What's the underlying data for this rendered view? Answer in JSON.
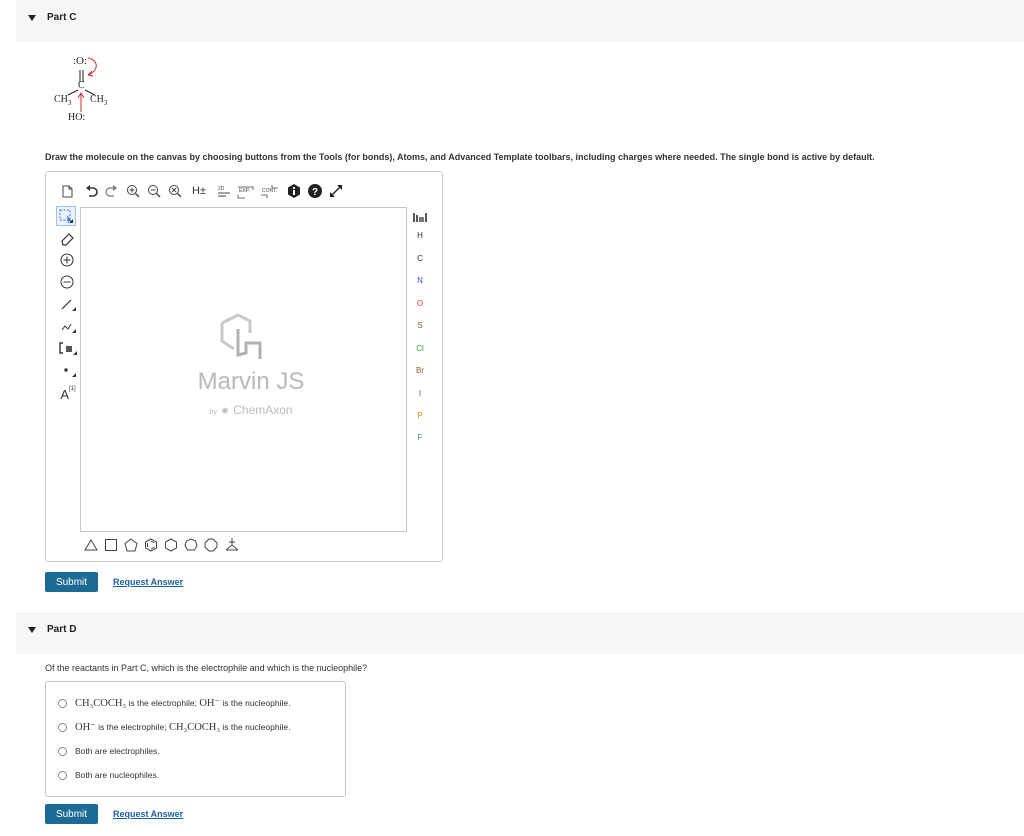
{
  "part_c": {
    "title": "Part C",
    "molecule": {
      "o_top": ":O:",
      "c_center": "C",
      "ch3_left": "CH",
      "ch3_right": "CH",
      "sub_3": "3",
      "ho": "HO:"
    },
    "instructions": "Draw the molecule on the canvas by choosing buttons from the Tools (for bonds), Atoms, and Advanced Template toolbars, including charges where needed. The single bond is active by default.",
    "top_toolbar": {
      "h_label": "H±",
      "d2_label": "2D",
      "exp_label": "EXP.",
      "cont_label": "CONT."
    },
    "left_toolbar": {
      "text_tool_label": "A",
      "text_tool_sup": "[1]"
    },
    "atoms": [
      "H",
      "C",
      "N",
      "O",
      "S",
      "Cl",
      "Br",
      "I",
      "P",
      "F"
    ],
    "periodic_label": "periodic-table",
    "logo": {
      "title": "Marvin JS",
      "byline": "by",
      "company": "ChemAxon"
    },
    "submit_label": "Submit",
    "request_label": "Request Answer"
  },
  "part_d": {
    "title": "Part D",
    "question": "Of the reactants in Part C, which is the electrophile and which is the nucleophile?",
    "choices": [
      {
        "a": "CH₃COCH₃",
        "t1": " is the electrophile; ",
        "b": "OH⁻",
        "t2": " is the nucleophile."
      },
      {
        "a": "OH⁻",
        "t1": " is the electrophile; ",
        "b": "CH₃COCH₃",
        "t2": " is the nucleophile."
      },
      {
        "text": "Both are electrophiles."
      },
      {
        "text": "Both are nucleophiles."
      }
    ],
    "submit_label": "Submit",
    "request_label": "Request Answer"
  },
  "colors": {
    "accent": "#1c6b94",
    "link": "#1c5f9e",
    "header_bg": "#f6f6f6",
    "atom_blue": "#3550d8",
    "atom_red": "#e53935",
    "atom_green": "#2ca52c",
    "atom_brown": "#8a5a2b",
    "atom_purple": "#7d3fae",
    "atom_orange": "#e08a00",
    "atom_teal": "#3a8c7e"
  }
}
